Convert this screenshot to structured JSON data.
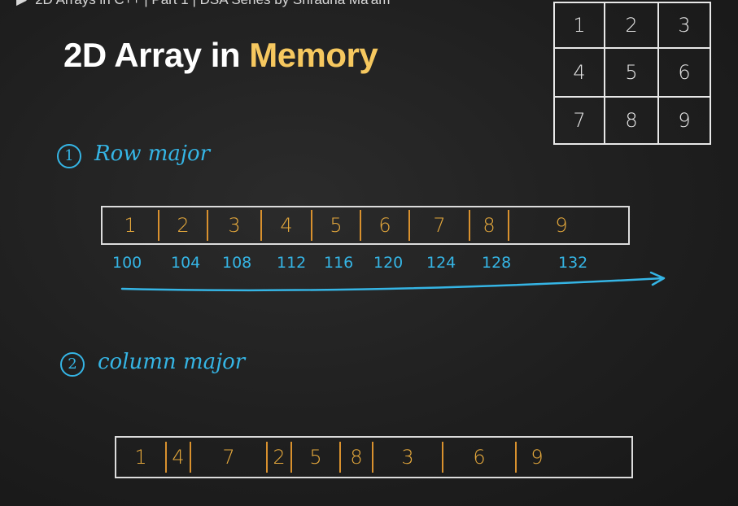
{
  "video_title": "2D Arrays in C++ | Part 1 | DSA Series by Shradha Ma'am",
  "title": {
    "main": "2D Array in ",
    "highlight": "Memory"
  },
  "matrix": [
    [
      "1",
      "2",
      "3"
    ],
    [
      "4",
      "5",
      "6"
    ],
    [
      "7",
      "8",
      "9"
    ]
  ],
  "row_major": {
    "number": "1",
    "label": "Row major",
    "values": [
      "1",
      "2",
      "3",
      "4",
      "5",
      "6",
      "7",
      "8",
      "9"
    ],
    "addresses": [
      "100",
      "104",
      "108",
      "112",
      "116",
      "120",
      "124",
      "128",
      "132"
    ]
  },
  "column_major": {
    "number": "2",
    "label": "column major",
    "values": [
      "1",
      "4",
      "7",
      "2",
      "5",
      "8",
      "3",
      "6",
      "9"
    ]
  },
  "colors": {
    "accent_blue": "#35b5e5",
    "accent_orange": "#e6a93c",
    "title_highlight": "#f6c85f"
  }
}
